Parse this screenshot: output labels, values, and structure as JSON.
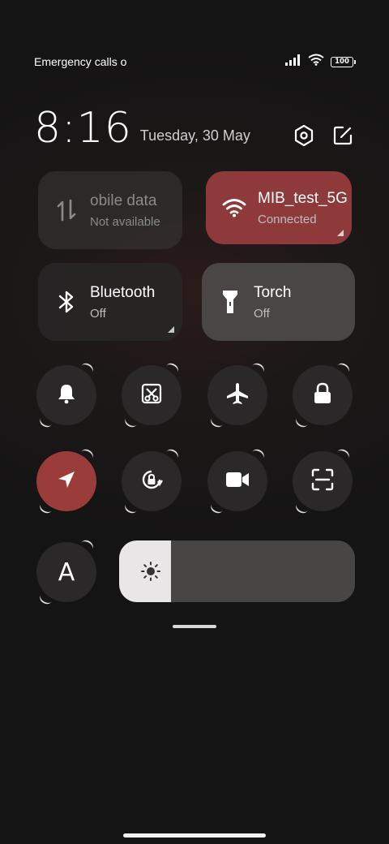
{
  "status_bar": {
    "carrier_text": "Emergency calls o",
    "battery_level": "100",
    "signal_icon": "cellular-signal-icon",
    "wifi_icon": "wifi-icon"
  },
  "header": {
    "time": "8:16",
    "date": "Tuesday, 30 May",
    "settings_icon": "settings-hexagon-icon",
    "edit_icon": "edit-icon"
  },
  "tiles": {
    "mobile_data": {
      "title": "obile data",
      "subtitle": "Not available",
      "icon": "mobile-data-icon"
    },
    "wifi": {
      "title": "MIB_test_5G",
      "subtitle": "Connected",
      "icon": "wifi-icon",
      "active_color": "#8f3a3a"
    },
    "bluetooth": {
      "title": "Bluetooth",
      "subtitle": "Off",
      "icon": "bluetooth-icon"
    },
    "torch": {
      "title": "Torch",
      "subtitle": "Off",
      "icon": "torch-icon"
    }
  },
  "round_toggles": [
    {
      "icon": "bell-icon",
      "active": false
    },
    {
      "icon": "screenshot-scissors-icon",
      "active": false
    },
    {
      "icon": "airplane-icon",
      "active": false
    },
    {
      "icon": "lock-icon",
      "active": false
    },
    {
      "icon": "location-arrow-icon",
      "active": true
    },
    {
      "icon": "rotation-lock-icon",
      "active": false
    },
    {
      "icon": "video-camera-icon",
      "active": false
    },
    {
      "icon": "scan-frame-icon",
      "active": false
    }
  ],
  "reading_mode": {
    "label": "A",
    "icon": "font-a-icon"
  },
  "brightness": {
    "level": 0.22,
    "icon": "sun-icon"
  },
  "colors": {
    "accent": "#9a3d3a",
    "panel": "#2a2828"
  }
}
